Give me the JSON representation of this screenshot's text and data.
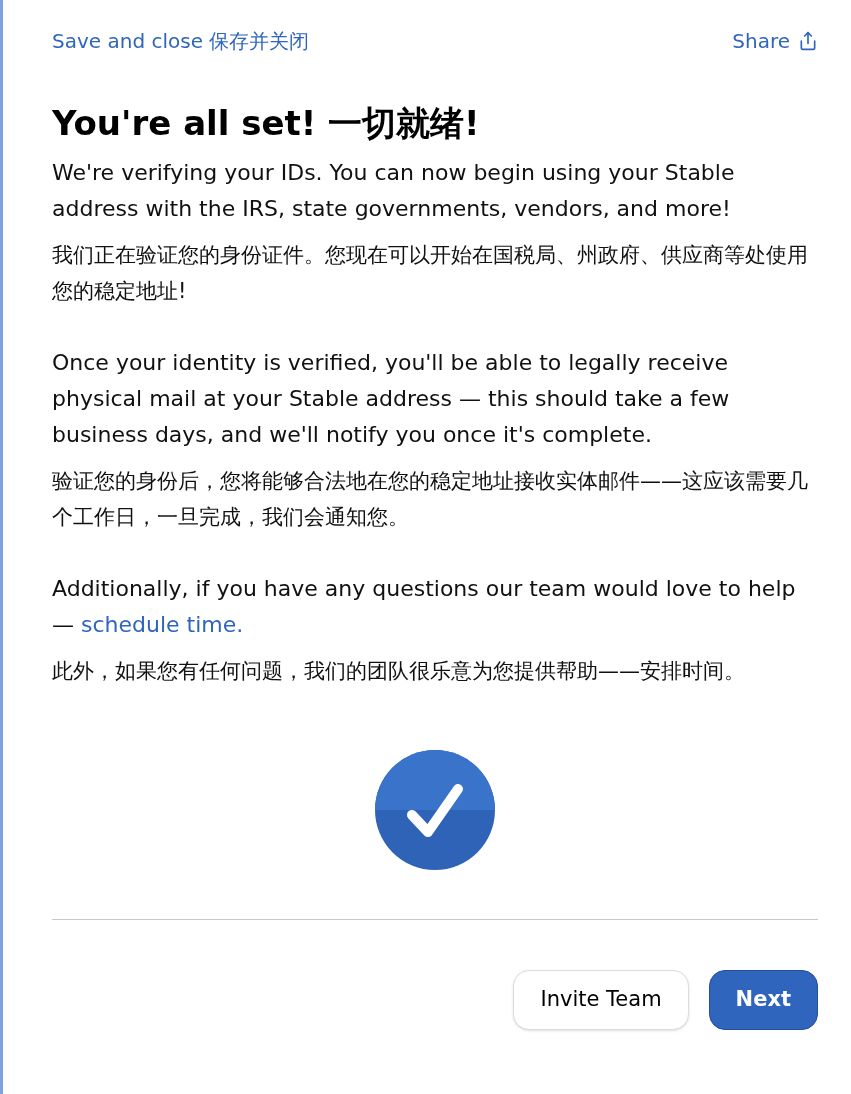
{
  "header": {
    "save_close": "Save and close 保存并关闭",
    "share": "Share"
  },
  "title": "You're all set! 一切就绪!",
  "paragraphs": [
    {
      "text": "We're verifying your IDs. You can now begin using your Stable address with the IRS, state governments, vendors, and more!",
      "translation": "我们正在验证您的身份证件。您现在可以开始在国税局、州政府、供应商等处使用您的稳定地址!"
    },
    {
      "text": "Once your identity is verified, you'll be able to legally receive physical mail at your Stable address — this should take a few business days, and we'll notify you once it's complete.",
      "translation": "验证您的身份后，您将能够合法地在您的稳定地址接收实体邮件——这应该需要几个工作日，一旦完成，我们会通知您。"
    },
    {
      "text": "Additionally, if you have any questions our team would love to help —",
      "link": "schedule time.",
      "translation": "此外，如果您有任何问题，我们的团队很乐意为您提供帮助——安排时间。"
    }
  ],
  "buttons": [
    {
      "label": "Invite Team",
      "kind": "secondary"
    },
    {
      "label": "Next",
      "kind": "primary"
    }
  ]
}
